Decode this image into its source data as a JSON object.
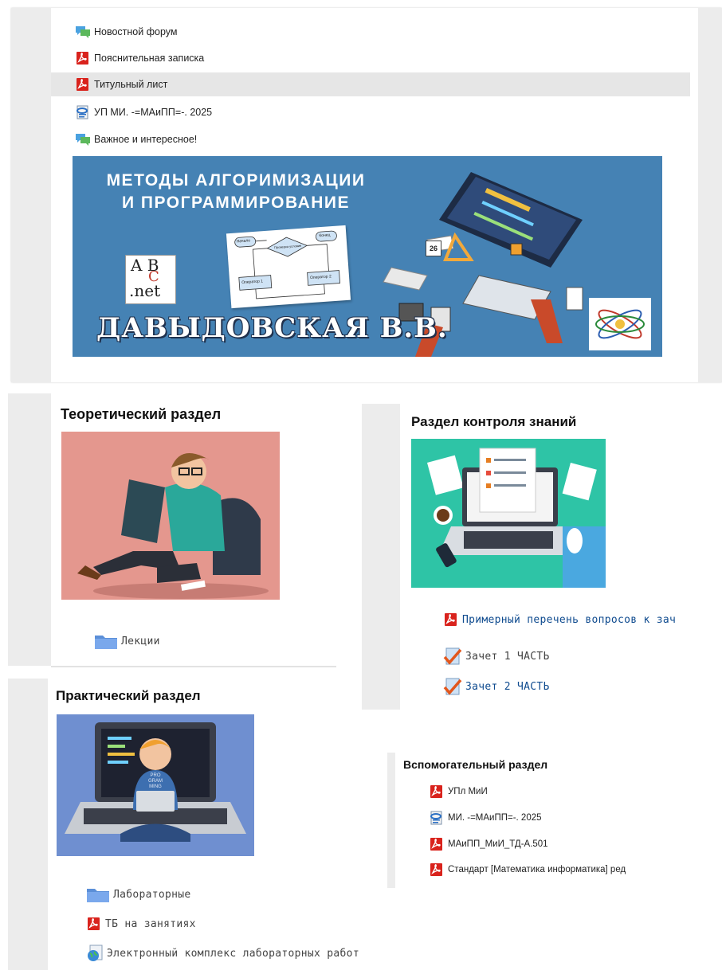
{
  "top_links": [
    {
      "label": "Новостной форум",
      "icon": "forum-icon"
    },
    {
      "label": "Пояснительная записка",
      "icon": "pdf-icon"
    },
    {
      "label": "Титульный лист",
      "icon": "pdf-icon"
    },
    {
      "label": "УП МИ. -=МАиПП=-. 2025",
      "icon": "document-icon"
    },
    {
      "label": "Важное и интересное!",
      "icon": "forum-icon"
    }
  ],
  "banner": {
    "title_line1": "МЕТОДЫ АЛГОРИМИЗАЦИИ",
    "title_line2": "И ПРОГРАММИРОВАНИЕ",
    "author": "ДАВЫДОВСКАЯ В.В.",
    "logo_line1": "A B",
    "logo_line2": ".net",
    "logo_c": "C",
    "flow_labels": [
      "Начало",
      "Проверка условия",
      "Конец",
      "Оператор 1",
      "Оператор 2"
    ],
    "calendar_day": "26"
  },
  "theory": {
    "title": "Теоретический раздел",
    "items": [
      {
        "label": "Лекции",
        "icon": "folder-icon"
      }
    ]
  },
  "control": {
    "title": "Раздел контроля знаний",
    "items": [
      {
        "label": "Примерный перечень вопросов к зач",
        "icon": "pdf-icon"
      },
      {
        "label": "Зачет 1 ЧАСТЬ",
        "icon": "quiz-icon"
      },
      {
        "label": "Зачет 2 ЧАСТЬ",
        "icon": "quiz-icon"
      }
    ]
  },
  "practice": {
    "title": "Практический раздел",
    "shirt_text": "PRO GRAM MING",
    "items": [
      {
        "label": "Лабораторные",
        "icon": "folder-icon"
      },
      {
        "label": "ТБ на занятиях",
        "icon": "pdf-icon"
      },
      {
        "label": "Электронный комплекс лабораторных работ",
        "icon": "globe-icon"
      }
    ]
  },
  "aux": {
    "title": "Вспомогательный раздел",
    "items": [
      {
        "label": "УПл МиИ",
        "icon": "pdf-icon"
      },
      {
        "label": "МИ. -=МАиПП=-. 2025",
        "icon": "document-icon"
      },
      {
        "label": "МАиПП_МиИ_ТД-А.501",
        "icon": "pdf-icon"
      },
      {
        "label": "Стандарт [Математика информатика] ред",
        "icon": "pdf-icon"
      }
    ]
  },
  "colors": {
    "banner_bg": "#4582b4",
    "theory_bg": "#e4978e",
    "control_bg": "#2ec4a6",
    "practice_bg": "#6f8fd0",
    "link_blue": "#0f4b8f",
    "gray_panel": "#ececec",
    "highlight_row": "#e6e6e6"
  }
}
